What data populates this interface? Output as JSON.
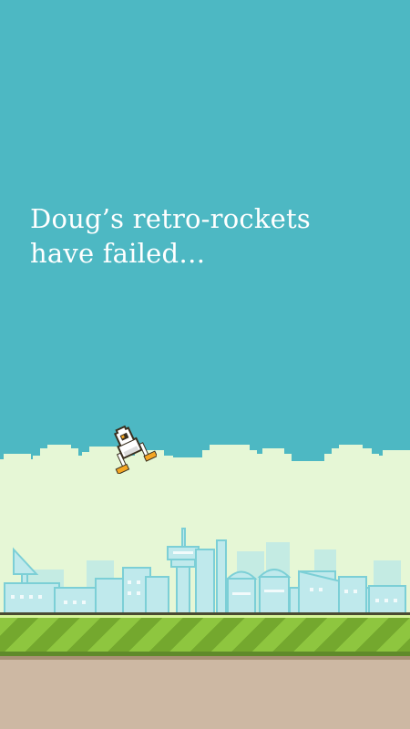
{
  "story": {
    "line1": "Doug’s retro-rockets",
    "line2": "have failed…"
  },
  "colors": {
    "sky": "#4db8c3",
    "cloud": "#e6f7d6",
    "city": "#b9e6e6",
    "grass_light": "#8ec63f",
    "grass_dark": "#74a82e",
    "dirt": "#cdb8a3"
  },
  "icons": {
    "character": "rocket-lander-icon"
  }
}
